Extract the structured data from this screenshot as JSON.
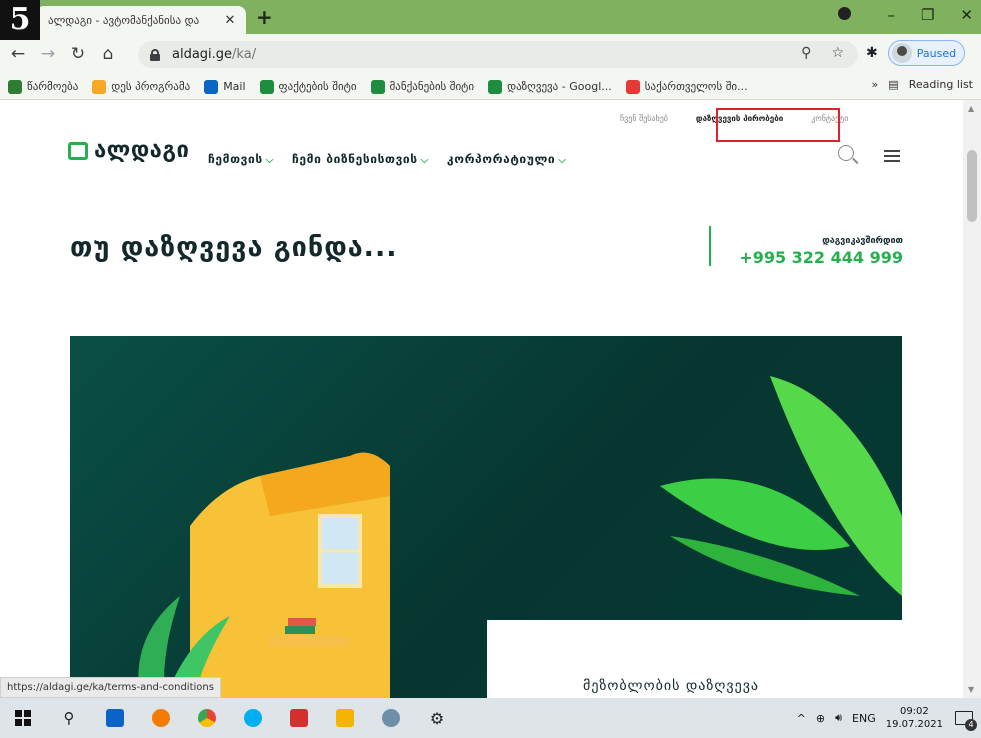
{
  "step_marker": "5",
  "browser": {
    "tab_title": "ალდაგი - ავტომანქანისა და",
    "address": {
      "host": "aldagi.ge",
      "path": "/ka/"
    },
    "profile_status": "Paused",
    "bookmarks": [
      {
        "label": "წარმოება",
        "color": "#2e7d32"
      },
      {
        "label": "დეს პროგრამა",
        "color": "#f9a825"
      },
      {
        "label": "Mail",
        "color": "#0a66c2"
      },
      {
        "label": "ფაქტების შიტი",
        "color": "#1e8e3e"
      },
      {
        "label": "მანქანების შიტი",
        "color": "#1e8e3e"
      },
      {
        "label": "დაზღვევა - Googl...",
        "color": "#1e8e3e"
      },
      {
        "label": "საქართველოს ში...",
        "color": "#e53935"
      }
    ],
    "bookmarks_overflow": "»",
    "reading_list": "Reading list",
    "status_url": "https://aldagi.ge/ka/terms-and-conditions"
  },
  "site": {
    "top_links": [
      "ჩვენ შესახებ",
      "დაზღვევის პირობები",
      "კონტაქტი"
    ],
    "active_top_link_index": 1,
    "logo": "ალდაგი",
    "nav": [
      "ჩემთვის",
      "ჩემი ბიზნესისთვის",
      "კორპორატიული"
    ],
    "hero_title": "თუ დაზღვევა გინდა...",
    "contact_label": "დაგვიკავშირდით",
    "contact_phone": "+995 322 444 999",
    "card_title": "მეზობლობის დაზღვევა",
    "colors": {
      "brand_green": "#22b14c",
      "banner_dark": "#06362f",
      "highlight": "#e0202a"
    }
  },
  "taskbar": {
    "apps": [
      {
        "name": "outlook",
        "color": "#0a64c8"
      },
      {
        "name": "firefox",
        "color": "#f57c00"
      },
      {
        "name": "chrome",
        "color": "#fbbc04"
      },
      {
        "name": "skype",
        "color": "#00aff0"
      },
      {
        "name": "acrobat",
        "color": "#d32f2f"
      },
      {
        "name": "file-explorer",
        "color": "#f4b400"
      },
      {
        "name": "paint",
        "color": "#6d8fa8"
      },
      {
        "name": "settings",
        "color": "#444444"
      }
    ],
    "language": "ENG",
    "time": "09:02",
    "date": "19.07.2021",
    "notification_count": "4"
  }
}
